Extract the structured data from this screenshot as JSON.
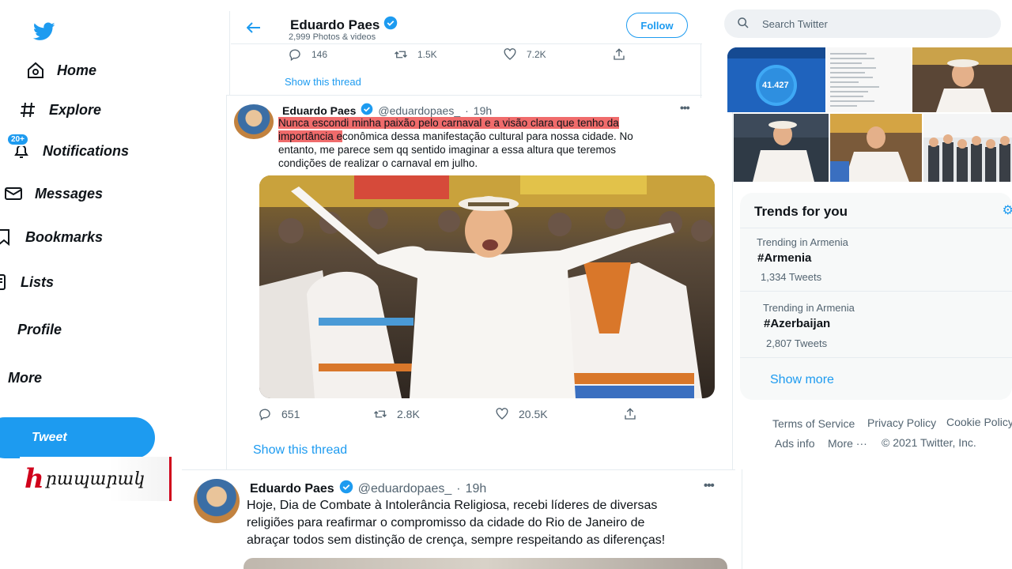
{
  "nav": {
    "items": [
      {
        "label": "Home",
        "icon": "home-icon"
      },
      {
        "label": "Explore",
        "icon": "hashtag-icon"
      },
      {
        "label": "Notifications",
        "icon": "bell-icon",
        "badge": "20+"
      },
      {
        "label": "Messages",
        "icon": "envelope-icon"
      },
      {
        "label": "Bookmarks",
        "icon": "bookmark-icon"
      },
      {
        "label": "Lists",
        "icon": "list-icon"
      },
      {
        "label": "Profile",
        "icon": "profile-icon"
      },
      {
        "label": "More",
        "icon": "more-icon"
      }
    ],
    "tweet_button": "Tweet"
  },
  "header": {
    "name": "Eduardo Paes",
    "subtitle": "2,999 Photos & videos",
    "follow_label": "Follow"
  },
  "prev_tweet": {
    "replies": "146",
    "retweets": "1.5K",
    "likes": "7.2K",
    "show_thread": "Show this thread"
  },
  "tweet1": {
    "name": "Eduardo Paes",
    "handle": "@eduardopaes_",
    "separator": "·",
    "time": "19h",
    "text_highlight_1": "Nunca escondi minha paixão pelo carnaval e a visão clara que tenho da",
    "text_highlight_2": "importância e",
    "text_rest_2": "conômica dessa manifestação cultural para nossa cidade.  No",
    "text_line_3": "entanto, me parece sem qq sentido imaginar a essa altura que teremos",
    "text_line_4": "condições de realizar o carnaval em julho.",
    "replies": "651",
    "retweets": "2.8K",
    "likes": "20.5K",
    "show_thread": "Show this thread"
  },
  "tweet2": {
    "name": "Eduardo Paes",
    "handle": "@eduardopaes_",
    "separator": "·",
    "time": "19h",
    "line_1": "Hoje, Dia de Combate à Intolerância Religiosa, recebi líderes de diversas",
    "line_2": "religiões para reafirmar o compromisso da cidade do Rio de Janeiro de",
    "line_3": "abraçar todos sem distinção de crença, sempre respeitando as diferenças!"
  },
  "search": {
    "placeholder": "Search Twitter"
  },
  "media": {
    "vacinometro_value": "41.427"
  },
  "trends": {
    "title": "Trends for you",
    "items": [
      {
        "context": "Trending in Armenia",
        "tag": "#Armenia",
        "count": "1,334 Tweets"
      },
      {
        "context": "Trending in Armenia",
        "tag": "#Azerbaijan",
        "count": "2,807 Tweets"
      }
    ],
    "show_more": "Show more"
  },
  "footer": {
    "terms": "Terms of Service",
    "privacy": "Privacy Policy",
    "cookie": "Cookie Policy",
    "ads": "Ads info",
    "more": "More ···",
    "copyright": "© 2021 Twitter, Inc."
  },
  "watermark": {
    "mark": "h",
    "text": "րապարակ"
  },
  "colors": {
    "accent": "#1d9bf0",
    "highlight": "#f06b6b",
    "watermark_red": "#d0021b"
  }
}
